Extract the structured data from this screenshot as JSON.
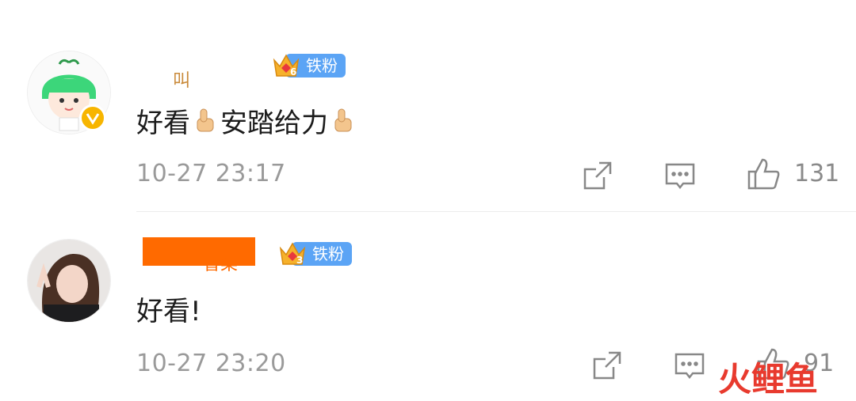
{
  "comments": [
    {
      "username_fragment": "叫",
      "fan_badge": {
        "level": "6",
        "label": "铁粉"
      },
      "text_a": "好看",
      "text_b": "安踏给力",
      "time": "10-27 23:17",
      "likes": "131"
    },
    {
      "username_fragment": "香菜",
      "fan_badge": {
        "level": "3",
        "label": "铁粉"
      },
      "text": "好看!",
      "time": "10-27 23:20",
      "likes": "91"
    }
  ],
  "watermark": {
    "a": "火",
    "b": "鲤",
    "c": "鱼"
  },
  "icons": {
    "share": "share-icon",
    "comment": "comment-icon",
    "like": "thumbs-up-icon",
    "emoji": "thumbs-up-emoji-icon"
  },
  "colors": {
    "fan_badge": "#5ba4f5",
    "verified": "#f7b500",
    "watermark": "#e83a2e"
  }
}
